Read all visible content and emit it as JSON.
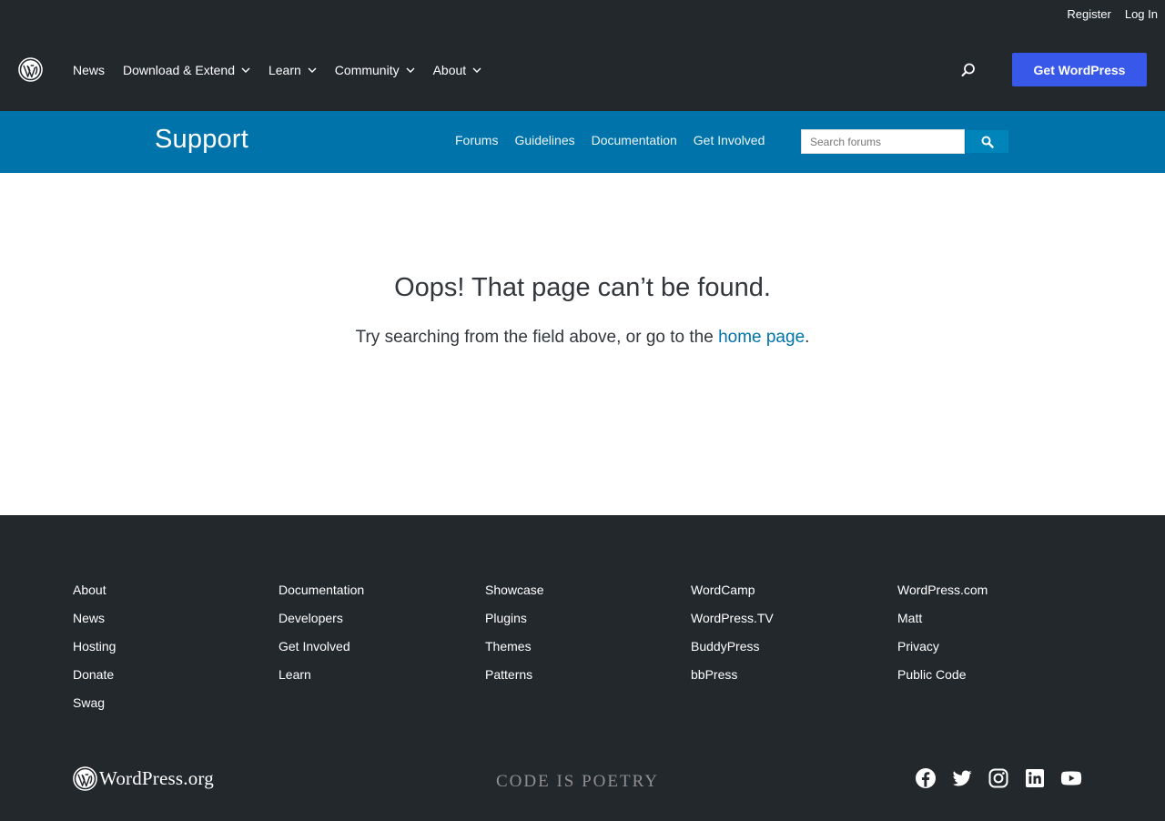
{
  "top_links": {
    "register": "Register",
    "login": "Log In"
  },
  "main_nav": [
    {
      "label": "News",
      "has_dropdown": false
    },
    {
      "label": "Download & Extend",
      "has_dropdown": true
    },
    {
      "label": "Learn",
      "has_dropdown": true
    },
    {
      "label": "Community",
      "has_dropdown": true
    },
    {
      "label": "About",
      "has_dropdown": true
    }
  ],
  "get_wordpress": "Get WordPress",
  "support_bar": {
    "title": "Support",
    "nav": [
      "Forums",
      "Guidelines",
      "Documentation",
      "Get Involved"
    ],
    "search_placeholder": "Search forums"
  },
  "error": {
    "title": "Oops! That page can’t be found.",
    "text_before": "Try searching from the field above, or go to the ",
    "link_text": "home page",
    "text_after": "."
  },
  "footer": {
    "columns": [
      [
        "About",
        "News",
        "Hosting",
        "Donate",
        "Swag"
      ],
      [
        "Documentation",
        "Developers",
        "Get Involved",
        "Learn"
      ],
      [
        "Showcase",
        "Plugins",
        "Themes",
        "Patterns"
      ],
      [
        "WordCamp",
        "WordPress.TV",
        "BuddyPress",
        "bbPress"
      ],
      [
        "WordPress.com",
        "Matt",
        "Privacy",
        "Public Code"
      ]
    ],
    "logo_text": "WordPress.org",
    "tagline": "CODE IS POETRY",
    "social_icons": [
      "facebook-icon",
      "twitter-icon",
      "instagram-icon",
      "linkedin-icon",
      "youtube-icon"
    ]
  },
  "colors": {
    "header_bg": "#23282d",
    "support_bg": "#0073aa",
    "accent_button": "#3858e9",
    "link": "#0073aa"
  }
}
